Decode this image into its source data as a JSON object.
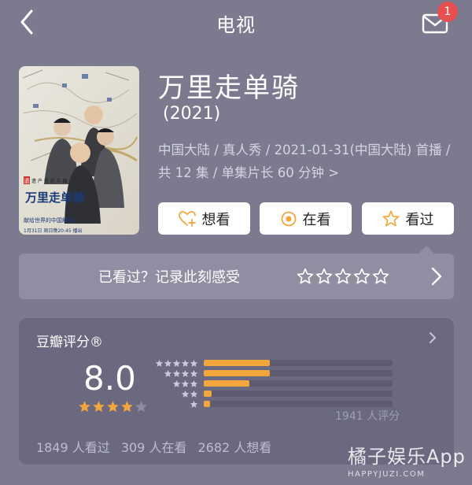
{
  "nav": {
    "title": "电视",
    "back_icon": "chevron-left-icon",
    "mail_icon": "mail-icon",
    "unread_count": "1"
  },
  "show": {
    "title": "万里走单骑",
    "year": "(2021)",
    "meta_line1": "中国大陆 / 真人秀 / 2021-01-31(中国大陆) 首播 /",
    "meta_line2": "共 12 集 / 单集片长 60 分钟",
    "meta_more": ">",
    "poster_badge": "遗",
    "poster_small_title": "遗 产 里 的 中 国",
    "poster_big_title": "万里走单骑",
    "poster_slogan": "献给世界的中国解伽",
    "poster_date": "1月31日 周日晚20:45 播出"
  },
  "actions": [
    {
      "label": "想看",
      "icon": "heart-plus-icon"
    },
    {
      "label": "在看",
      "icon": "target-icon"
    },
    {
      "label": "看过",
      "icon": "star-outline-icon"
    }
  ],
  "record": {
    "prompt": "已看过？记录此刻感受",
    "star_count": 5
  },
  "rating": {
    "title": "豆瓣评分®",
    "score": "8.0",
    "score_stars": 4,
    "max_stars": 5,
    "distribution": [
      {
        "stars": 5,
        "fraction": 0.35
      },
      {
        "stars": 4,
        "fraction": 0.35
      },
      {
        "stars": 3,
        "fraction": 0.24
      },
      {
        "stars": 2,
        "fraction": 0.04
      },
      {
        "stars": 1,
        "fraction": 0.035
      }
    ],
    "count_label": "1941 人评分",
    "stats": [
      "1849 人看过",
      "309 人在看",
      "2682 人想看"
    ]
  },
  "colors": {
    "background": "#7b7a8f",
    "card": "#6a6980",
    "accent": "#f2a63b",
    "badge": "#e84f4f"
  },
  "watermark": {
    "main": "橘子娱乐App",
    "sub": "HAPPYJUZI.COM"
  }
}
